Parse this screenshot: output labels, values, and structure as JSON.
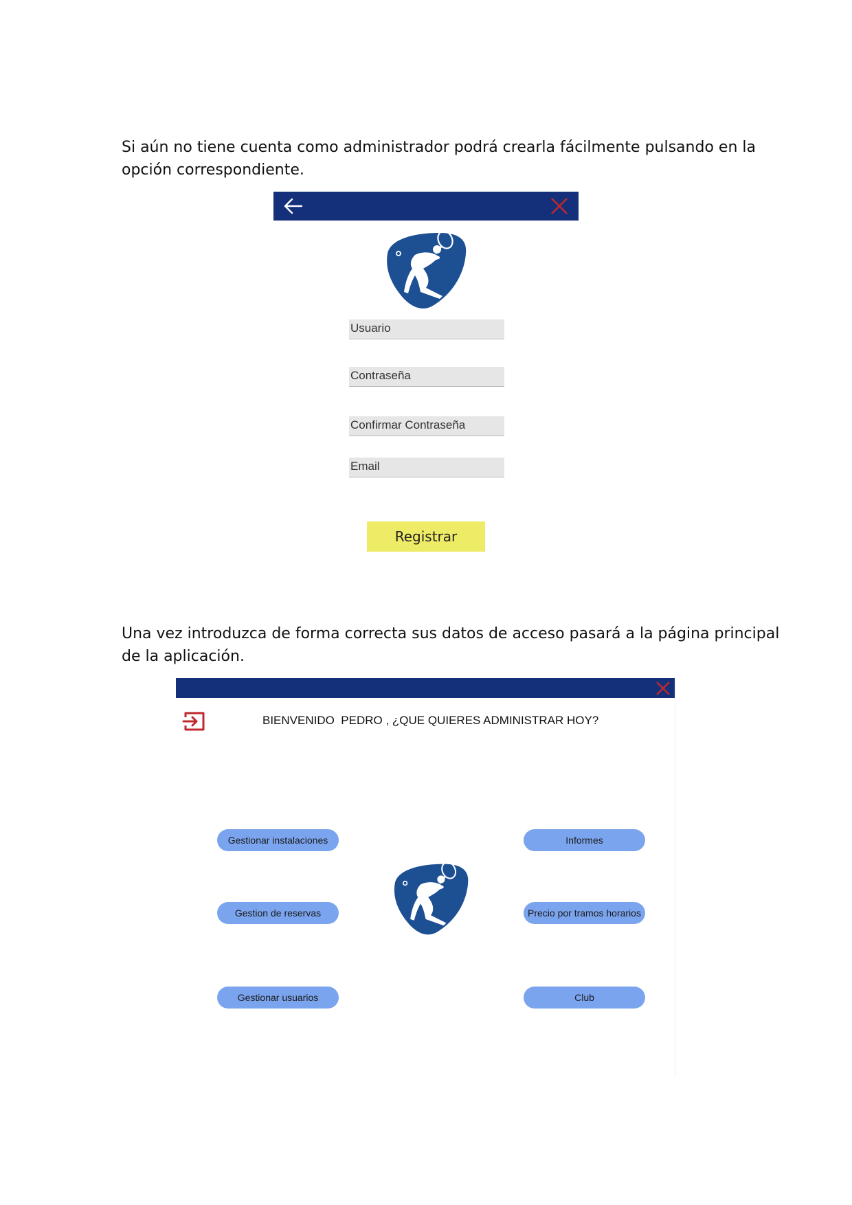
{
  "intro": {
    "line1": "Si aún no tiene cuenta como administrador podrá crearla fácilmente pulsando en la",
    "line2": "opción correspondiente."
  },
  "register_screen": {
    "fields": {
      "usuario": "Usuario",
      "contrasena": "Contraseña",
      "confirmar": "Confirmar Contraseña",
      "email": "Email"
    },
    "register_label": "Registrar",
    "colors": {
      "bar": "#14307a",
      "button": "#eeeb66",
      "close": "#c0282d"
    },
    "icons": [
      "back-arrow-icon",
      "close-icon",
      "tennis-player-logo"
    ]
  },
  "second_paragraph": {
    "line1": "Una vez introduzca de forma correcta sus datos de acceso pasará a la página principal",
    "line2": "de la aplicación."
  },
  "main_screen": {
    "welcome": "BIENVENIDO  PEDRO , ¿QUE QUIERES ADMINISTRAR HOY?",
    "buttons": {
      "instalaciones": "Gestionar instalaciones",
      "informes": "Informes",
      "reservas": "Gestion de reservas",
      "precio": "Precio por tramos horarios",
      "usuarios": "Gestionar usuarios",
      "club": "Club"
    },
    "colors": {
      "bar": "#14307a",
      "button": "#7ba4ee",
      "logout": "#c0282d"
    },
    "icons": [
      "logout-icon",
      "close-icon",
      "tennis-player-logo"
    ]
  }
}
